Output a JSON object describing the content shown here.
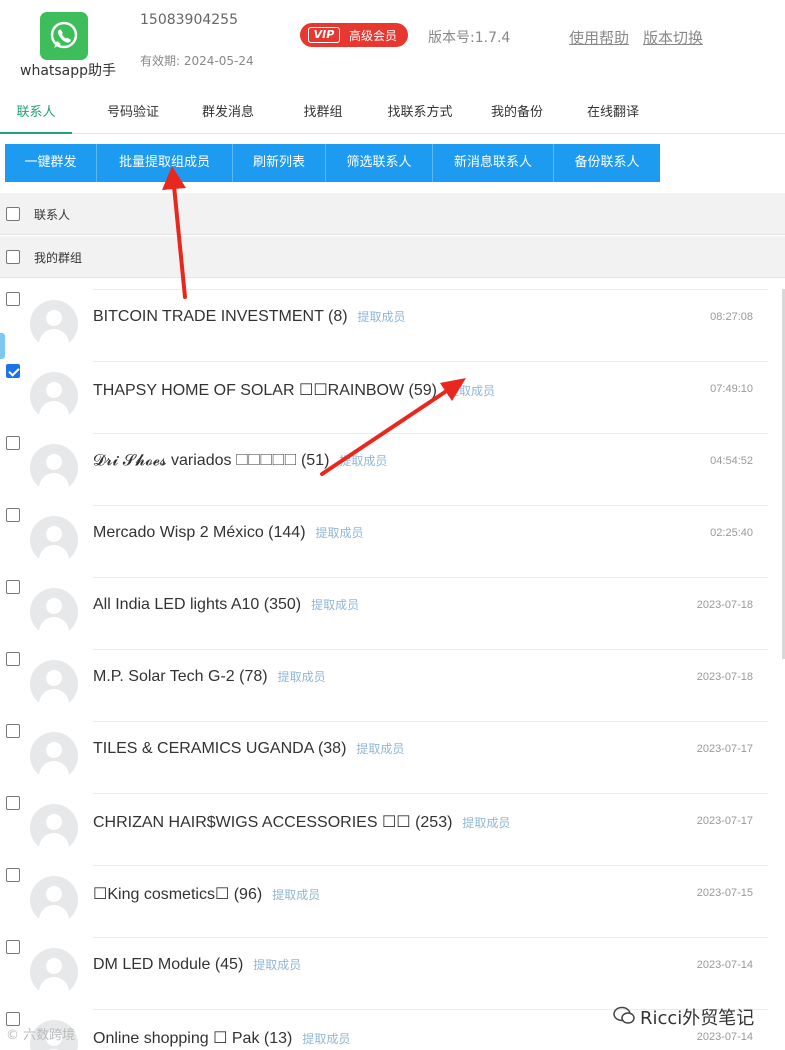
{
  "header": {
    "app_name": "whatsapp助手",
    "phone": "15083904255",
    "expiry": "有效期: 2024-05-24",
    "vip_tag": "VIP",
    "vip_label": "高级会员",
    "version": "版本号:1.7.4",
    "help_link": "使用帮助",
    "switch_link": "版本切换"
  },
  "tabs": [
    {
      "label": "联系人",
      "active": true
    },
    {
      "label": "号码验证"
    },
    {
      "label": "群发消息"
    },
    {
      "label": "找群组"
    },
    {
      "label": "找联系方式"
    },
    {
      "label": "我的备份"
    },
    {
      "label": "在线翻译"
    }
  ],
  "toolbar": [
    {
      "label": "一键群发"
    },
    {
      "label": "批量提取组成员"
    },
    {
      "label": "刷新列表"
    },
    {
      "label": "筛选联系人"
    },
    {
      "label": "新消息联系人"
    },
    {
      "label": "备份联系人"
    }
  ],
  "sections": {
    "contacts_label": "联系人",
    "groups_label": "我的群组"
  },
  "extract_label": "提取成员",
  "groups": [
    {
      "name": "BITCOIN TRADE INVESTMENT (8)",
      "time": "08:27:08",
      "checked": false
    },
    {
      "name": "THAPSY HOME OF SOLAR ☐☐RAINBOW (59)",
      "time": "07:49:10",
      "checked": true
    },
    {
      "name": "𝓓𝓻𝓲 𝓢𝓱𝓸𝓮𝓼 variados ☐☐☐☐☐ (51)",
      "time": "04:54:52",
      "checked": false
    },
    {
      "name": "Mercado Wisp 2 México (144)",
      "time": "02:25:40",
      "checked": false
    },
    {
      "name": "All India LED lights A10 (350)",
      "time": "2023-07-18",
      "checked": false
    },
    {
      "name": "M.P. Solar Tech G-2 (78)",
      "time": "2023-07-18",
      "checked": false
    },
    {
      "name": "TILES & CERAMICS UGANDA (38)",
      "time": "2023-07-17",
      "checked": false
    },
    {
      "name": "CHRIZAN HAIR$WIGS ACCESSORIES ☐☐ (253)",
      "time": "2023-07-17",
      "checked": false
    },
    {
      "name": "☐King cosmetics☐ (96)",
      "time": "2023-07-15",
      "checked": false
    },
    {
      "name": "DM LED Module (45)",
      "time": "2023-07-14",
      "checked": false
    },
    {
      "name": "Online shopping ☐ Pak (13)",
      "time": "2023-07-14",
      "checked": false
    }
  ],
  "watermarks": {
    "left": "© 六数跨境",
    "right": "Ricci外贸笔记"
  },
  "colors": {
    "accent_green": "#22a37a",
    "button_blue": "#1d9bf0",
    "vip_red": "#e7372f",
    "arrow_red": "#e8271f"
  }
}
